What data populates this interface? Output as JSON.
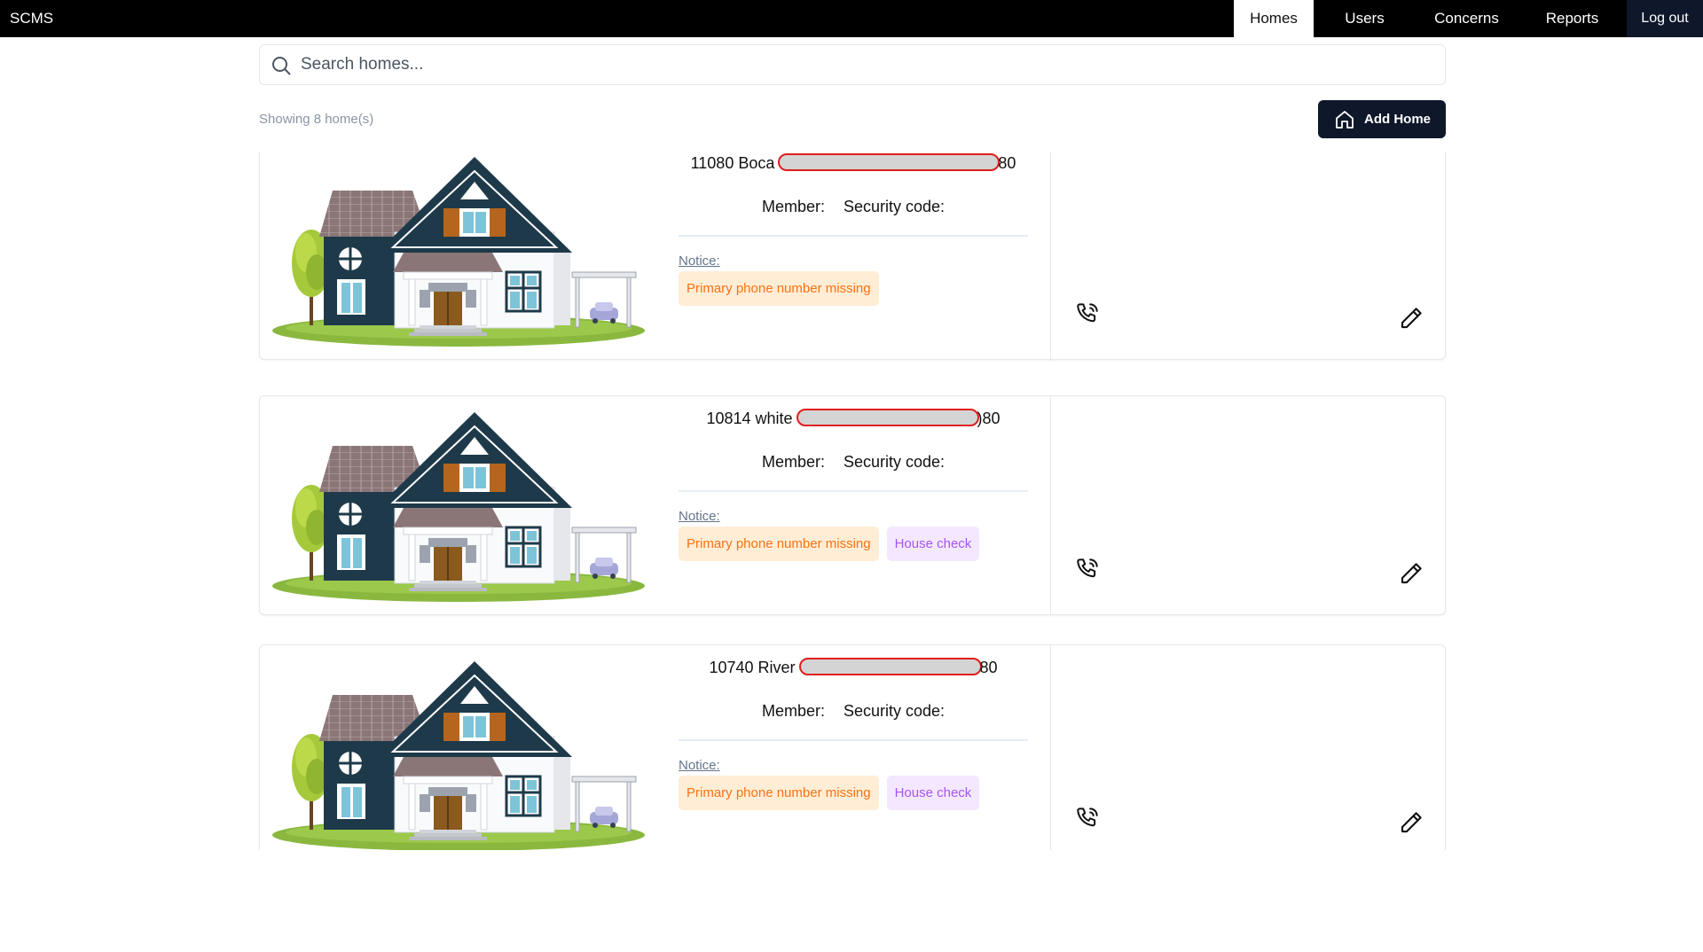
{
  "app": {
    "brand": "SCMS"
  },
  "nav": {
    "homes": "Homes",
    "users": "Users",
    "concerns": "Concerns",
    "reports": "Reports",
    "logout": "Log out"
  },
  "search": {
    "placeholder": "Search homes..."
  },
  "summary": {
    "showing": "Showing 8 home(s)"
  },
  "add_home": {
    "label": "Add Home"
  },
  "labels": {
    "member": "Member:",
    "security_code": "Security code:",
    "notice": "Notice:"
  },
  "homes": [
    {
      "address_start": "11080 Boca",
      "address_end": "80",
      "tags": [
        "Primary phone number missing"
      ]
    },
    {
      "address_start": "10814 white",
      "address_end": ")80",
      "tags": [
        "Primary phone number missing",
        "House check"
      ]
    },
    {
      "address_start": "10740 River",
      "address_end": "80",
      "tags": [
        "Primary phone number missing",
        "House check"
      ]
    }
  ],
  "icons": {
    "search": "search-icon",
    "add_home": "home-icon",
    "phone": "phone-call-icon",
    "edit": "pencil-icon"
  },
  "colors": {
    "topbar": "#000000",
    "primary_button": "#0f172a",
    "tag_orange_bg": "#ffedd5",
    "tag_orange_text": "#f97316",
    "tag_purple_bg": "#f3e8ff",
    "tag_purple_text": "#a855f7",
    "redaction_outline": "#e11d1d"
  }
}
